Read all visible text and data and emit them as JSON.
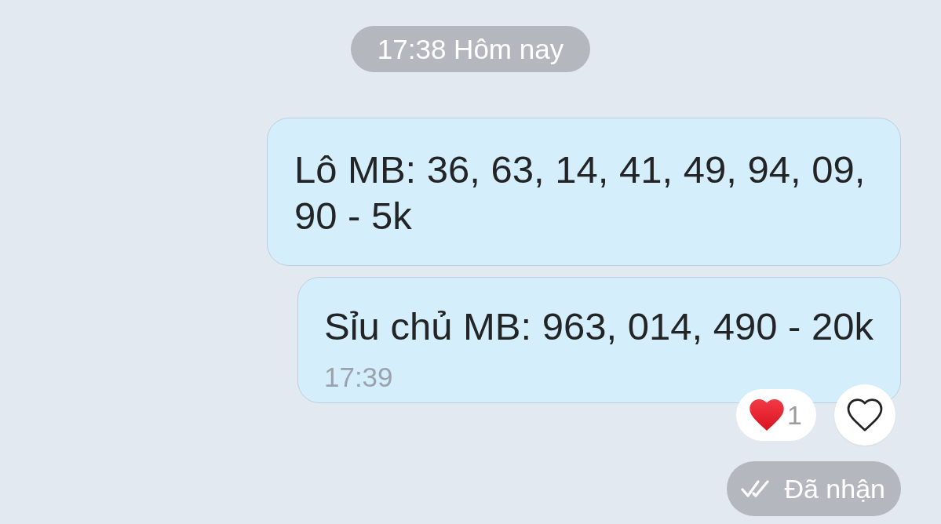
{
  "date_separator": "17:38 Hôm nay",
  "messages": [
    {
      "text": "Lô MB: 36, 63, 14, 41, 49, 94, 09, 90 - 5k"
    },
    {
      "text": "Sỉu chủ MB: 963, 014, 490 - 20k",
      "time": "17:39"
    }
  ],
  "reaction_summary": {
    "count": "1"
  },
  "react_button": {
    "liked": false
  },
  "status": "Đã nhận"
}
